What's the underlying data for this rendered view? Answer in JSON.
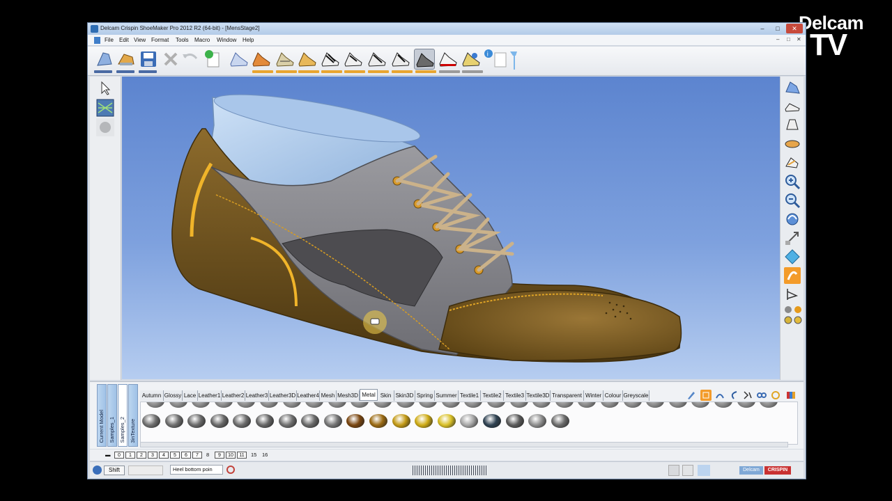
{
  "watermark": {
    "line1": "Delcam",
    "line2": "TV"
  },
  "window": {
    "title": "Delcam Crispin ShoeMaker Pro 2012 R2 (64-bit) - [MensStage2]",
    "controls": {
      "minimize": "–",
      "maximize": "□",
      "close": "✕"
    }
  },
  "menubar": {
    "items": [
      "File",
      "Edit",
      "View",
      "Format",
      "Tools",
      "Macro",
      "Window",
      "Help"
    ],
    "mdi_controls": [
      "–",
      "□",
      "✕"
    ]
  },
  "toolbar": {
    "icons": [
      "last-icon",
      "style-icon",
      "save-icon",
      "delete-icon",
      "undo-icon",
      "new-icon",
      "shoe-wire-icon",
      "shoe-orange-icon",
      "shoe-lines-icon",
      "shoe-lines-2-icon",
      "shoe-lace-icon",
      "shoe-lace-2-icon",
      "shoe-lace-3-icon",
      "shoe-lace-4-icon",
      "shoe-dark-icon",
      "shoe-sole-icon",
      "shoe-color-icon",
      "info-icon",
      "page-icon",
      "pin-icon"
    ]
  },
  "materials": {
    "vertical_tabs": [
      "Current Model",
      "Samples_1",
      "Samples_2",
      "3inTexture"
    ],
    "tabs": [
      "Autumn",
      "Glossy",
      "Lace",
      "Leather1",
      "Leather2",
      "Leather3",
      "Leather3D",
      "Leather4",
      "Mesh",
      "Mesh3D",
      "Metal",
      "Skin",
      "Skin3D",
      "Spring",
      "Summer",
      "Textile1",
      "Textile2",
      "Textile3",
      "Textile3D",
      "Transparent",
      "Winter",
      "Colour",
      "Greyscale"
    ],
    "active_tab": "Metal",
    "swatch_colors": [
      "#707070",
      "#6e6e6e",
      "#6a6a6a",
      "#686868",
      "#6c6c6c",
      "#666666",
      "#707070",
      "#6a6a6a",
      "#767676",
      "#7a4610",
      "#9b6a12",
      "#c39a16",
      "#cfac17",
      "#d9c027",
      "#a6a6a6",
      "#2f4252",
      "#5a5a5a",
      "#8e8e8e",
      "#6b6b6b"
    ]
  },
  "bottom": {
    "layer_boxes": [
      "0",
      "1",
      "2",
      "3",
      "4",
      "5",
      "6",
      "7"
    ],
    "layer_plain": [
      "8"
    ],
    "layer_boxes2": [
      "9",
      "10",
      "11"
    ],
    "layer_plain2": [
      "15",
      "16"
    ],
    "shift_label": "Shift",
    "select_value": "Heel bottom poin",
    "logo_left": "Delcam",
    "logo_right": "CRISPIN"
  }
}
